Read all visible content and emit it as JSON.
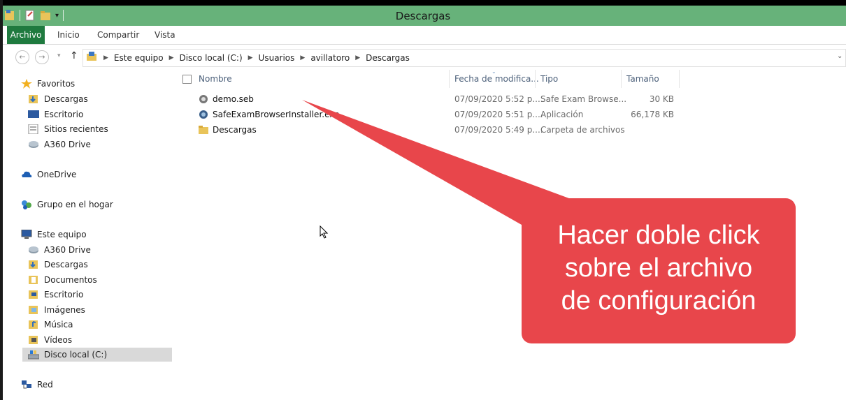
{
  "window": {
    "title": "Descargas"
  },
  "ribbon": {
    "tabs": [
      "Archivo",
      "Inicio",
      "Compartir",
      "Vista"
    ]
  },
  "address": {
    "crumbs": [
      "Este equipo",
      "Disco local (C:)",
      "Usuarios",
      "avillatoro",
      "Descargas"
    ]
  },
  "sidebar": {
    "favorites": {
      "label": "Favoritos",
      "items": [
        "Descargas",
        "Escritorio",
        "Sitios recientes",
        "A360 Drive"
      ]
    },
    "onedrive": "OneDrive",
    "homegroup": "Grupo en el hogar",
    "thispc": {
      "label": "Este equipo",
      "items": [
        "A360 Drive",
        "Descargas",
        "Documentos",
        "Escritorio",
        "Imágenes",
        "Música",
        "Vídeos",
        "Disco local (C:)"
      ]
    },
    "network": "Red"
  },
  "columns": {
    "name": "Nombre",
    "date": "Fecha de modifica...",
    "type": "Tipo",
    "size": "Tamaño"
  },
  "files": [
    {
      "name": "demo.seb",
      "date": "07/09/2020 5:52 p....",
      "type": "Safe Exam Browse...",
      "size": "30 KB",
      "icon": "seb-file-icon"
    },
    {
      "name": "SafeExamBrowserInstaller.exe",
      "date": "07/09/2020 5:51 p....",
      "type": "Aplicación",
      "size": "66,178 KB",
      "icon": "installer-icon"
    },
    {
      "name": "Descargas",
      "date": "07/09/2020 5:49 p....",
      "type": "Carpeta de archivos",
      "size": "",
      "icon": "folder-icon"
    }
  ],
  "callout": {
    "line1": "Hacer doble click",
    "line2": "sobre el archivo",
    "line3": "de configuración",
    "color": "#e8464b"
  }
}
